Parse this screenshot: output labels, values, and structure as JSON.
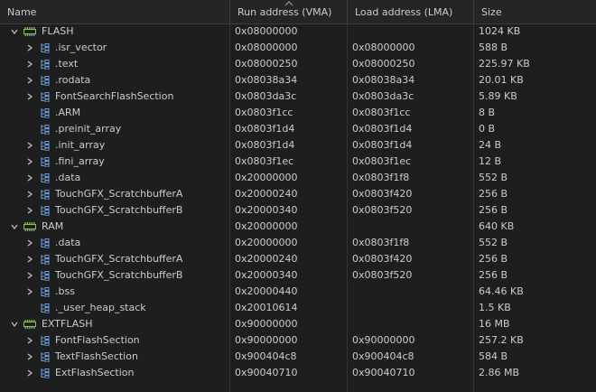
{
  "columns": {
    "name": "Name",
    "vma": "Run address (VMA)",
    "lma": "Load address (LMA)",
    "size": "Size"
  },
  "colors": {
    "background": "#1e1e1e",
    "text": "#cccccc",
    "memory_icon": "#8fbf5f",
    "section_icon": "#6c9bd2"
  },
  "icons": {
    "memory": "memory-region-icon",
    "section": "section-icon",
    "expanded": "chevron-down-icon",
    "collapsed": "chevron-right-icon",
    "sort": "sort-ascending-icon"
  },
  "regions": [
    {
      "name": "FLASH",
      "vma": "0x08000000",
      "lma": "",
      "size": "1024 KB",
      "sections": [
        {
          "name": ".isr_vector",
          "vma": "0x08000000",
          "lma": "0x08000000",
          "size": "588 B",
          "expandable": true
        },
        {
          "name": ".text",
          "vma": "0x08000250",
          "lma": "0x08000250",
          "size": "225.97 KB",
          "expandable": true
        },
        {
          "name": ".rodata",
          "vma": "0x08038a34",
          "lma": "0x08038a34",
          "size": "20.01 KB",
          "expandable": true
        },
        {
          "name": "FontSearchFlashSection",
          "vma": "0x0803da3c",
          "lma": "0x0803da3c",
          "size": "5.89 KB",
          "expandable": true
        },
        {
          "name": ".ARM",
          "vma": "0x0803f1cc",
          "lma": "0x0803f1cc",
          "size": "8 B",
          "expandable": false
        },
        {
          "name": ".preinit_array",
          "vma": "0x0803f1d4",
          "lma": "0x0803f1d4",
          "size": "0 B",
          "expandable": false
        },
        {
          "name": ".init_array",
          "vma": "0x0803f1d4",
          "lma": "0x0803f1d4",
          "size": "24 B",
          "expandable": true
        },
        {
          "name": ".fini_array",
          "vma": "0x0803f1ec",
          "lma": "0x0803f1ec",
          "size": "12 B",
          "expandable": true
        },
        {
          "name": ".data",
          "vma": "0x20000000",
          "lma": "0x0803f1f8",
          "size": "552 B",
          "expandable": true
        },
        {
          "name": "TouchGFX_ScratchbufferA",
          "vma": "0x20000240",
          "lma": "0x0803f420",
          "size": "256 B",
          "expandable": true
        },
        {
          "name": "TouchGFX_ScratchbufferB",
          "vma": "0x20000340",
          "lma": "0x0803f520",
          "size": "256 B",
          "expandable": true
        }
      ]
    },
    {
      "name": "RAM",
      "vma": "0x20000000",
      "lma": "",
      "size": "640 KB",
      "sections": [
        {
          "name": ".data",
          "vma": "0x20000000",
          "lma": "0x0803f1f8",
          "size": "552 B",
          "expandable": true
        },
        {
          "name": "TouchGFX_ScratchbufferA",
          "vma": "0x20000240",
          "lma": "0x0803f420",
          "size": "256 B",
          "expandable": true
        },
        {
          "name": "TouchGFX_ScratchbufferB",
          "vma": "0x20000340",
          "lma": "0x0803f520",
          "size": "256 B",
          "expandable": true
        },
        {
          "name": ".bss",
          "vma": "0x20000440",
          "lma": "",
          "size": "64.46 KB",
          "expandable": true
        },
        {
          "name": "._user_heap_stack",
          "vma": "0x20010614",
          "lma": "",
          "size": "1.5 KB",
          "expandable": false
        }
      ]
    },
    {
      "name": "EXTFLASH",
      "vma": "0x90000000",
      "lma": "",
      "size": "16 MB",
      "sections": [
        {
          "name": "FontFlashSection",
          "vma": "0x90000000",
          "lma": "0x90000000",
          "size": "257.2 KB",
          "expandable": true
        },
        {
          "name": "TextFlashSection",
          "vma": "0x900404c8",
          "lma": "0x900404c8",
          "size": "584 B",
          "expandable": true
        },
        {
          "name": "ExtFlashSection",
          "vma": "0x90040710",
          "lma": "0x90040710",
          "size": "2.86 MB",
          "expandable": true
        }
      ]
    }
  ]
}
